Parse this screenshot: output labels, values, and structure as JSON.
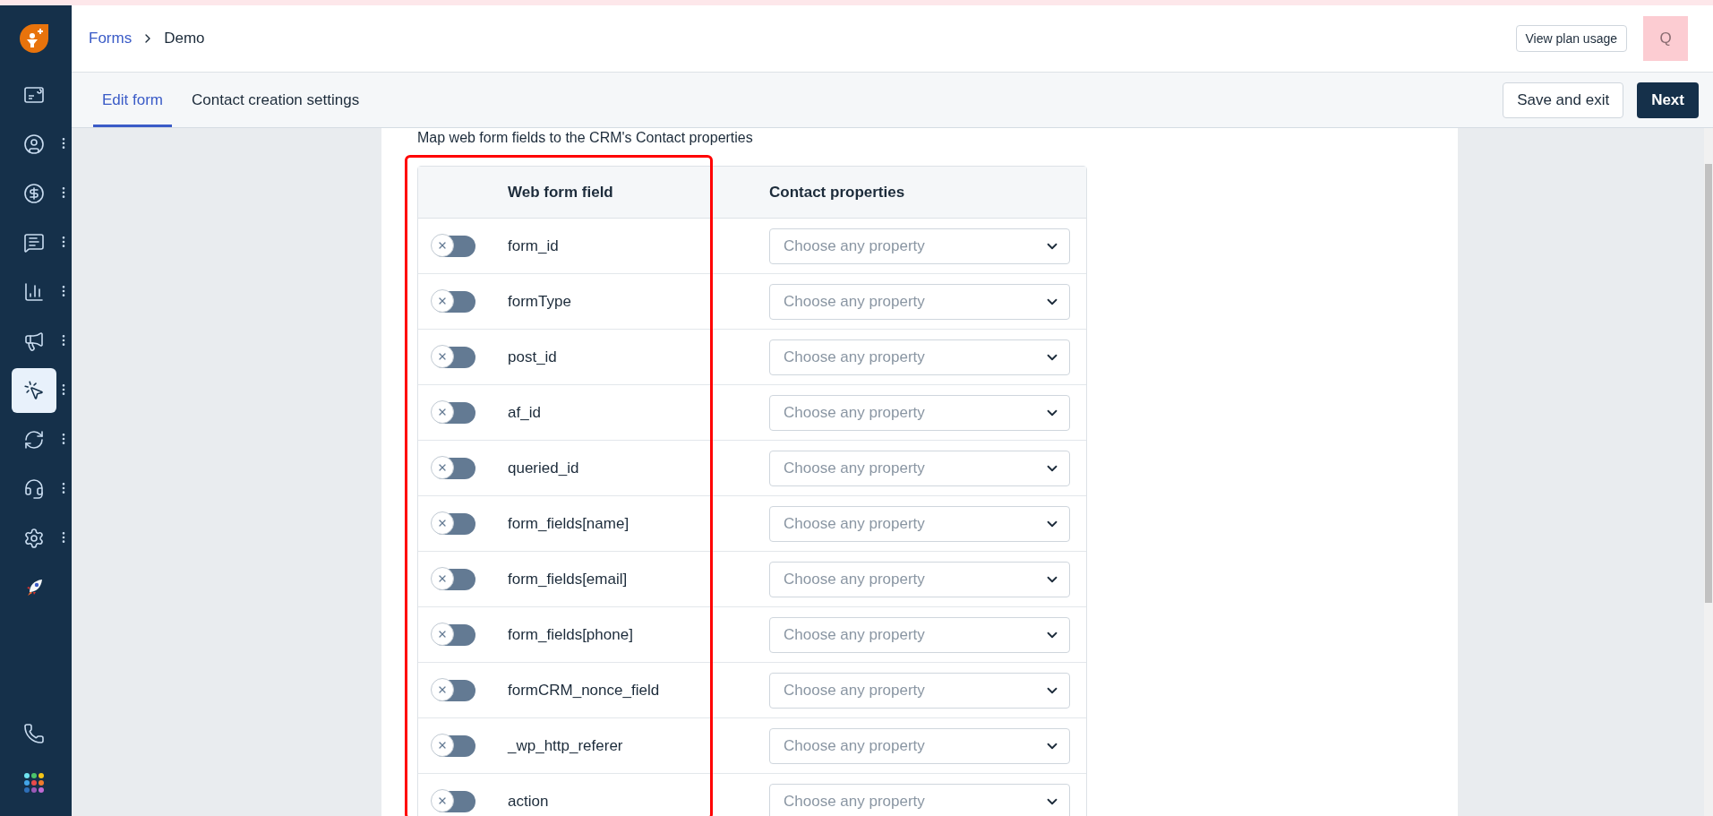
{
  "sidebar": {
    "items": [
      {
        "selected": false,
        "has_menu": false
      },
      {
        "selected": false,
        "has_menu": true
      },
      {
        "selected": false,
        "has_menu": true
      },
      {
        "selected": false,
        "has_menu": true
      },
      {
        "selected": false,
        "has_menu": true
      },
      {
        "selected": false,
        "has_menu": true
      },
      {
        "selected": true,
        "has_menu": true
      },
      {
        "selected": false,
        "has_menu": true
      },
      {
        "selected": false,
        "has_menu": true
      },
      {
        "selected": false,
        "has_menu": true
      },
      {
        "selected": false,
        "has_menu": false
      }
    ]
  },
  "breadcrumb": [
    "Forms",
    "Demo"
  ],
  "header": {
    "plan_button": "View plan usage",
    "avatar": "Q"
  },
  "tabs": [
    {
      "label": "Edit form",
      "selected": true
    },
    {
      "label": "Contact creation settings",
      "selected": false
    }
  ],
  "actions": {
    "secondary": "Save and exit",
    "primary": "Next"
  },
  "mapping": {
    "title": "Map web form fields to the CRM's Contact properties",
    "columns": [
      "Web form field",
      "Contact properties"
    ],
    "rows": [
      {
        "field": "form_id",
        "on": false,
        "placeholder": "Choose any property"
      },
      {
        "field": "formType",
        "on": false,
        "placeholder": "Choose any property"
      },
      {
        "field": "post_id",
        "on": false,
        "placeholder": "Choose any property"
      },
      {
        "field": "af_id",
        "on": false,
        "placeholder": "Choose any property"
      },
      {
        "field": "queried_id",
        "on": false,
        "placeholder": "Choose any property"
      },
      {
        "field": "form_fields[name]",
        "on": false,
        "placeholder": "Choose any property"
      },
      {
        "field": "form_fields[email]",
        "on": false,
        "placeholder": "Choose any property"
      },
      {
        "field": "form_fields[phone]",
        "on": false,
        "placeholder": "Choose any property"
      },
      {
        "field": "formCRM_nonce_field",
        "on": false,
        "placeholder": "Choose any property"
      },
      {
        "field": "_wp_http_referer",
        "on": false,
        "placeholder": "Choose any property"
      },
      {
        "field": "action",
        "on": false,
        "placeholder": "Choose any property"
      }
    ]
  }
}
